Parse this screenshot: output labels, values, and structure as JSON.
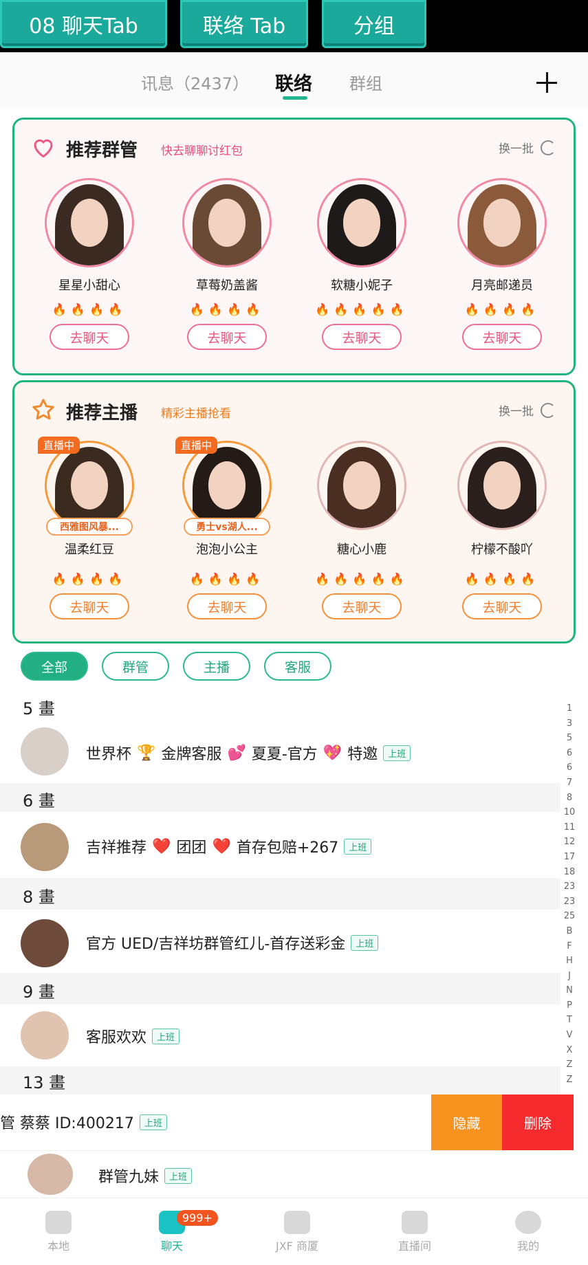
{
  "top_buttons": [
    "08 聊天Tab",
    "联络 Tab",
    "分组"
  ],
  "tabs": {
    "messages": "讯息（2437）",
    "contacts": "联络",
    "groups": "群组"
  },
  "card_groups": {
    "title": "推荐群管",
    "subtitle": "快去聊聊讨红包",
    "refresh": "换一批",
    "people": [
      {
        "name": "星星小甜心",
        "fires": "🔥🔥🔥🔥",
        "button": "去聊天"
      },
      {
        "name": "草莓奶盖酱",
        "fires": "🔥🔥🔥🔥",
        "button": "去聊天"
      },
      {
        "name": "软糖小妮子",
        "fires": "🔥🔥🔥🔥🔥",
        "button": "去聊天"
      },
      {
        "name": "月亮邮递员",
        "fires": "🔥🔥🔥🔥",
        "button": "去聊天"
      }
    ]
  },
  "card_hosts": {
    "title": "推荐主播",
    "subtitle": "精彩主播抢看",
    "refresh": "换一批",
    "live_label": "直播中",
    "people": [
      {
        "name": "温柔红豆",
        "fires": "🔥🔥🔥🔥",
        "button": "去聊天",
        "tag": "西雅图风暴..."
      },
      {
        "name": "泡泡小公主",
        "fires": "🔥🔥🔥🔥",
        "button": "去聊天",
        "tag": "勇士vs湖人..."
      },
      {
        "name": "糖心小鹿",
        "fires": "🔥🔥🔥🔥🔥",
        "button": "去聊天"
      },
      {
        "name": "柠檬不酸吖",
        "fires": "🔥🔥🔥🔥",
        "button": "去聊天"
      }
    ]
  },
  "filters": [
    "全部",
    "群管",
    "主播",
    "客服"
  ],
  "sections": [
    "5 畫",
    "6 畫",
    "8 畫",
    "9 畫",
    "13 畫"
  ],
  "contacts": [
    {
      "a": "世界杯",
      "e1": "🏆",
      "b": "金牌客服",
      "e2": "💕",
      "c": "夏夏-官方",
      "e3": "💖",
      "d": "特邀",
      "status": "上班"
    },
    {
      "a": "吉祥推荐",
      "e1": "❤️",
      "b": "团团",
      "e2": "❤️",
      "c": "首存包赔+267",
      "status": "上班"
    },
    {
      "a": "官方 UED/吉祥坊群管红儿-首存送彩金",
      "status": "上班"
    },
    {
      "a": "客服欢欢",
      "status": "上班"
    },
    {
      "a": "管 蔡蔡 ID:400217",
      "status": "上班"
    },
    {
      "a": "群管九妹",
      "status": "上班"
    }
  ],
  "swipe": {
    "hide": "隐藏",
    "delete": "删除"
  },
  "alpha_index": [
    "1",
    "3",
    "5",
    "6",
    "6",
    "7",
    "8",
    "10",
    "11",
    "12",
    "17",
    "18",
    "23",
    "23",
    "25",
    "B",
    "F",
    "H",
    "J",
    "N",
    "P",
    "T",
    "V",
    "X",
    "Z",
    "Z"
  ],
  "nav": {
    "items": [
      "本地",
      "聊天",
      "JXF 商厦",
      "直播间",
      "我的"
    ],
    "badge": "999+"
  }
}
